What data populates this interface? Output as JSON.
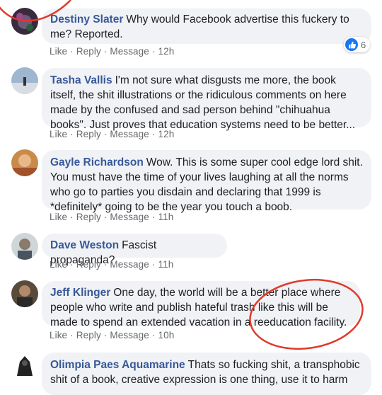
{
  "comments": [
    {
      "author": "Destiny Slater",
      "text": "Why would Facebook advertise this fuckery to me? Reported.",
      "actions": {
        "like": "Like",
        "reply": "Reply",
        "message": "Message",
        "time": "12h"
      },
      "reactions": "6"
    },
    {
      "author": "Tasha Vallis",
      "text": "I'm not sure what disgusts me more, the book itself, the shit illustrations or the ridiculous comments on here made by the confused and sad person behind \"chihuahua books\". Just proves that education systems need to be better...",
      "actions": {
        "like": "Like",
        "reply": "Reply",
        "message": "Message",
        "time": "12h"
      }
    },
    {
      "author": "Gayle Richardson",
      "text": "Wow. This is some super cool edge lord shit. You must have the time of your lives laughing at all the norms who go to parties you disdain and declaring that 1999 is *definitely* going to be the year you touch a boob.",
      "actions": {
        "like": "Like",
        "reply": "Reply",
        "message": "Message",
        "time": "11h"
      }
    },
    {
      "author": "Dave Weston",
      "text": "Fascist propaganda?",
      "actions": {
        "like": "Like",
        "reply": "Reply",
        "message": "Message",
        "time": "11h"
      }
    },
    {
      "author": "Jeff Klinger",
      "text": "One day, the world will be a better place where people who write and publish hateful trash like this will be made to spend an extended vacation in a reeducation facility.",
      "actions": {
        "like": "Like",
        "reply": "Reply",
        "message": "Message",
        "time": "10h"
      }
    },
    {
      "author": "Olimpia Paes Aquamarine",
      "text": "Thats so fucking shit, a transphobic shit of a book, creative expression is one thing, use it to harm"
    }
  ],
  "colors": {
    "author": "#385898",
    "bubble": "#f0f2f5",
    "annotation": "#e0392b",
    "like": "#1877f2"
  },
  "icons": [
    "like-icon"
  ]
}
